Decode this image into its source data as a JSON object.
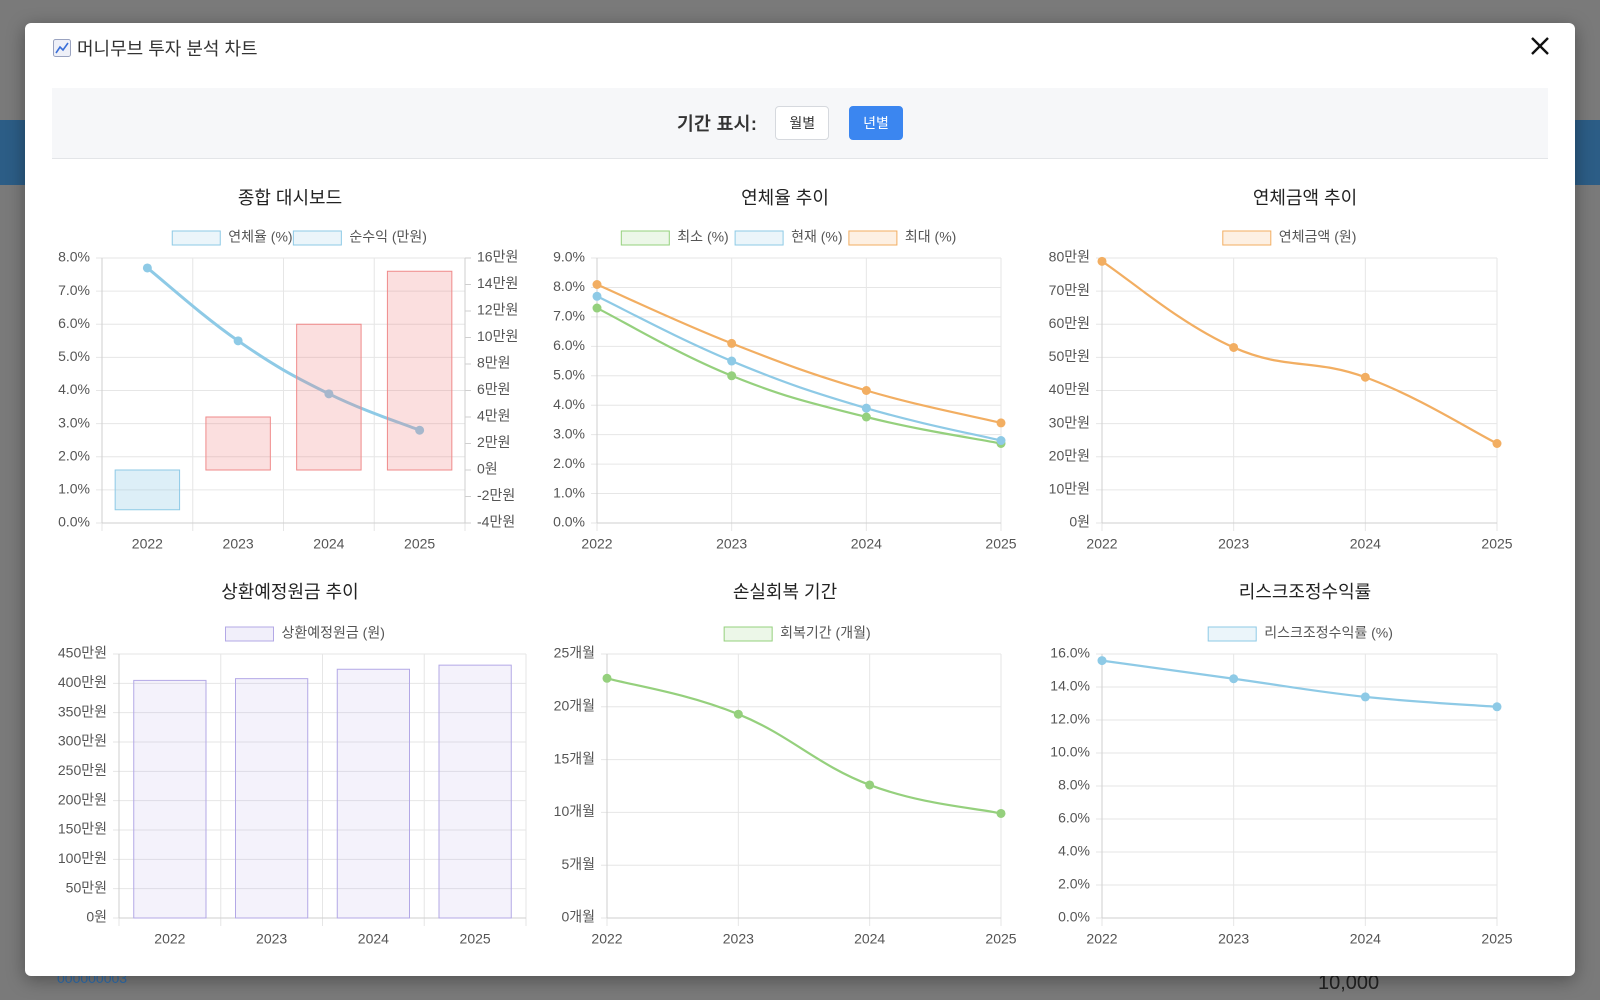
{
  "background": {
    "row_id": "000000003",
    "amount": "10,000"
  },
  "modal": {
    "title": "머니무브 투자 분석 차트",
    "close_icon": "close-icon",
    "title_icon": "chart-line-icon"
  },
  "toolbar": {
    "label": "기간 표시:",
    "monthly": "월별",
    "yearly": "년별",
    "active": "yearly",
    "active_color": "#3b86f0"
  },
  "chart_data": [
    {
      "id": "c1",
      "type": "bar+line",
      "title": "종합 대시보드",
      "categories": [
        "2022",
        "2023",
        "2024",
        "2025"
      ],
      "series": [
        {
          "name": "연체율 (%)",
          "kind": "line",
          "axis": "left",
          "values": [
            7.7,
            5.5,
            3.9,
            2.8
          ],
          "color": "#8ecae6"
        },
        {
          "name": "순수익 (만원)",
          "kind": "bar",
          "axis": "right",
          "values": [
            -3,
            4,
            11,
            15
          ]
        }
      ],
      "y_left": {
        "min": 0,
        "max": 8,
        "step": 1,
        "ticks": [
          "0.0%",
          "1.0%",
          "2.0%",
          "3.0%",
          "4.0%",
          "5.0%",
          "6.0%",
          "7.0%",
          "8.0%"
        ]
      },
      "y_right": {
        "min": -4,
        "max": 16,
        "step": 2,
        "ticks": [
          "-4만원",
          "-2만원",
          "0원",
          "2만원",
          "4만원",
          "6만원",
          "8만원",
          "10만원",
          "12만원",
          "14만원",
          "16만원"
        ]
      },
      "grid": true,
      "legend": "top-center"
    },
    {
      "id": "c2",
      "type": "line",
      "title": "연체율 추이",
      "categories": [
        "2022",
        "2023",
        "2024",
        "2025"
      ],
      "series": [
        {
          "name": "최소 (%)",
          "values": [
            7.3,
            5.0,
            3.6,
            2.7
          ],
          "color": "#95d07d"
        },
        {
          "name": "현재 (%)",
          "values": [
            7.7,
            5.5,
            3.9,
            2.8
          ],
          "color": "#8ecae6"
        },
        {
          "name": "최대 (%)",
          "values": [
            8.1,
            6.1,
            4.5,
            3.4
          ],
          "color": "#f2ae62"
        }
      ],
      "y": {
        "min": 0,
        "max": 9,
        "step": 1,
        "ticks": [
          "0.0%",
          "1.0%",
          "2.0%",
          "3.0%",
          "4.0%",
          "5.0%",
          "6.0%",
          "7.0%",
          "8.0%",
          "9.0%"
        ]
      },
      "grid": true,
      "legend": "top-center"
    },
    {
      "id": "c3",
      "type": "line",
      "title": "연체금액 추이",
      "categories": [
        "2022",
        "2023",
        "2024",
        "2025"
      ],
      "series": [
        {
          "name": "연체금액 (원)",
          "values": [
            79,
            53,
            44,
            24
          ],
          "color": "#f2ae62"
        }
      ],
      "y": {
        "min": 0,
        "max": 80,
        "step": 10,
        "ticks": [
          "0원",
          "10만원",
          "20만원",
          "30만원",
          "40만원",
          "50만원",
          "60만원",
          "70만원",
          "80만원"
        ]
      },
      "grid": true,
      "legend": "top-center"
    },
    {
      "id": "c4",
      "type": "bar",
      "title": "상환예정원금 추이",
      "categories": [
        "2022",
        "2023",
        "2024",
        "2025"
      ],
      "series": [
        {
          "name": "상환예정원금 (원)",
          "values": [
            405,
            408,
            424,
            431
          ],
          "color": "#b3a8e6"
        }
      ],
      "y": {
        "min": 0,
        "max": 450,
        "step": 50,
        "ticks": [
          "0원",
          "50만원",
          "100만원",
          "150만원",
          "200만원",
          "250만원",
          "300만원",
          "350만원",
          "400만원",
          "450만원"
        ]
      },
      "grid": true,
      "legend": "top-center"
    },
    {
      "id": "c5",
      "type": "line",
      "title": "손실회복 기간",
      "categories": [
        "2022",
        "2023",
        "2024",
        "2025"
      ],
      "series": [
        {
          "name": "회복기간 (개월)",
          "values": [
            22.7,
            19.3,
            12.6,
            9.9
          ],
          "color": "#95d07d"
        }
      ],
      "y": {
        "min": 0,
        "max": 25,
        "step": 5,
        "ticks": [
          "0개월",
          "5개월",
          "10개월",
          "15개월",
          "20개월",
          "25개월"
        ]
      },
      "grid": true,
      "legend": "top-center"
    },
    {
      "id": "c6",
      "type": "line",
      "title": "리스크조정수익률",
      "categories": [
        "2022",
        "2023",
        "2024",
        "2025"
      ],
      "series": [
        {
          "name": "리스크조정수익률 (%)",
          "values": [
            15.6,
            14.5,
            13.4,
            12.8
          ],
          "color": "#8ecae6"
        }
      ],
      "y": {
        "min": 0,
        "max": 16,
        "step": 2,
        "ticks": [
          "0.0%",
          "2.0%",
          "4.0%",
          "6.0%",
          "8.0%",
          "10.0%",
          "12.0%",
          "14.0%",
          "16.0%"
        ]
      },
      "grid": true,
      "legend": "top-center"
    }
  ]
}
